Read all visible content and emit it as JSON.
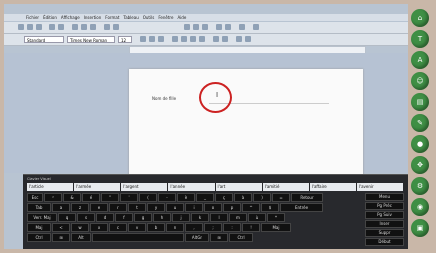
{
  "menu": {
    "items": [
      "Fichier",
      "Édition",
      "Affichage",
      "Insertion",
      "Format",
      "Tableau",
      "Outils",
      "Fenêtre",
      "Aide"
    ]
  },
  "toolbar": {
    "style_value": "Standard",
    "font_value": "Times New Roman",
    "size_value": "12"
  },
  "document": {
    "field_label": "Nom de fille",
    "cursor_char": "I"
  },
  "keyboard": {
    "title": "Clavier Visuel",
    "predictions": [
      "l'article",
      "l'armée",
      "l'argent",
      "l'année",
      "l'art",
      "l'amitié",
      "l'affaire",
      "l'avenir"
    ],
    "rows": [
      [
        "Esc",
        "²",
        "&",
        "é",
        "\"",
        "'",
        "(",
        "-",
        "è",
        "_",
        "ç",
        "à",
        ")",
        "=",
        "Retour"
      ],
      [
        "Tab",
        "a",
        "z",
        "e",
        "r",
        "t",
        "y",
        "u",
        "i",
        "o",
        "p",
        "^",
        "$",
        "Entrée"
      ],
      [
        "Verr. Maj",
        "q",
        "s",
        "d",
        "f",
        "g",
        "h",
        "j",
        "k",
        "l",
        "m",
        "ù",
        "*"
      ],
      [
        "Maj",
        "<",
        "w",
        "x",
        "c",
        "v",
        "b",
        "n",
        ",",
        ";",
        ":",
        "!",
        "Maj"
      ],
      [
        "Ctrl",
        "⊞",
        "Alt",
        "",
        "AltGr",
        "⊞",
        "Ctrl"
      ]
    ],
    "side_keys": [
      "Menu",
      "Pg Préc",
      "Pg Suiv",
      "Inser",
      "Suppr",
      "Début",
      "Fin"
    ]
  },
  "dock": {
    "icons": [
      "home-icon",
      "text-icon",
      "font-size-icon",
      "user-icon",
      "book-icon",
      "pen-icon",
      "mic-icon",
      "move-icon",
      "settings-icon",
      "record-icon",
      "folder-icon",
      "power-icon"
    ]
  }
}
